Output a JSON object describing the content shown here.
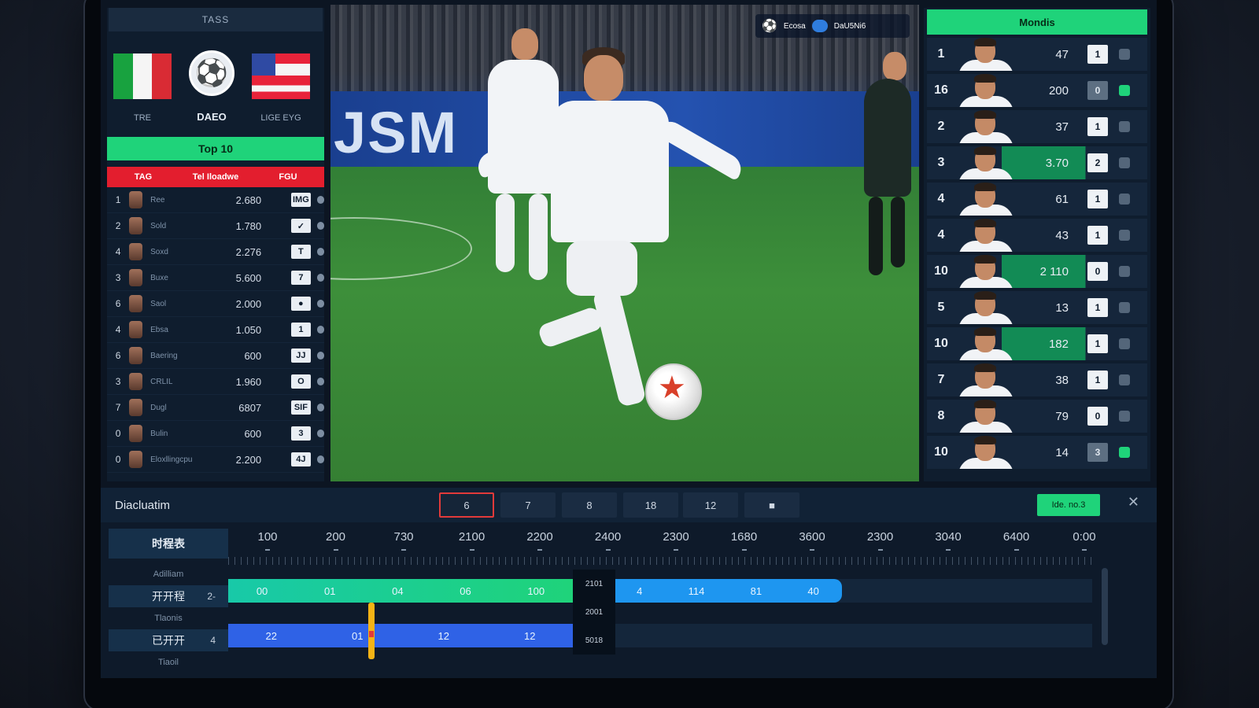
{
  "left_panel": {
    "header": "TASS",
    "team_left": "TRE",
    "team_mid": "DAEO",
    "team_right": "LIGE EYG",
    "top_button": "Top 10",
    "table_headers": [
      "TAG",
      "Tel Iloadwe",
      "FGU"
    ],
    "rows": [
      {
        "rank": "1",
        "name": "Ree",
        "score": "2.680",
        "box": "IMG"
      },
      {
        "rank": "2",
        "name": "Sold",
        "score": "1.780",
        "box": "✓"
      },
      {
        "rank": "4",
        "name": "Soxd",
        "score": "2.276",
        "box": "T"
      },
      {
        "rank": "3",
        "name": "Buxe",
        "score": "5.600",
        "box": "7"
      },
      {
        "rank": "6",
        "name": "Saol",
        "score": "2.000",
        "box": "●"
      },
      {
        "rank": "4",
        "name": "Ebsa",
        "score": "1.050",
        "box": "1"
      },
      {
        "rank": "6",
        "name": "Baering",
        "score": "600",
        "box": "JJ"
      },
      {
        "rank": "3",
        "name": "CRLIL",
        "score": "1.960",
        "box": "O"
      },
      {
        "rank": "7",
        "name": "Dugl",
        "score": "6807",
        "box": "SIF"
      },
      {
        "rank": "0",
        "name": "Bulin",
        "score": "600",
        "box": "3"
      },
      {
        "rank": "0",
        "name": "Eloxllingcpu",
        "score": "2.200",
        "box": "4J"
      }
    ]
  },
  "video": {
    "board_text": "JSM",
    "hud_label": "Ecosa",
    "hud_right": "DaU5Ni6"
  },
  "right_panel": {
    "header": "Mondis",
    "rows": [
      {
        "rank": "1",
        "value": "47",
        "box": "1",
        "icon": "gray"
      },
      {
        "rank": "16",
        "value": "200",
        "box": "0",
        "icon": "green",
        "dim": true
      },
      {
        "rank": "2",
        "value": "37",
        "box": "1",
        "icon": "gray"
      },
      {
        "rank": "3",
        "value": "3.70",
        "box": "2",
        "icon": "gray",
        "highlight": true
      },
      {
        "rank": "4",
        "value": "61",
        "box": "1",
        "icon": "gray"
      },
      {
        "rank": "4",
        "value": "43",
        "box": "1",
        "icon": "gray"
      },
      {
        "rank": "10",
        "value": "2 110",
        "box": "0",
        "icon": "gray",
        "highlight": true
      },
      {
        "rank": "5",
        "value": "13",
        "box": "1",
        "icon": "gray"
      },
      {
        "rank": "10",
        "value": "182",
        "box": "1",
        "icon": "gray",
        "highlight": true
      },
      {
        "rank": "7",
        "value": "38",
        "box": "1",
        "icon": "gray"
      },
      {
        "rank": "8",
        "value": "79",
        "box": "0",
        "icon": "gray"
      },
      {
        "rank": "10",
        "value": "14",
        "box": "3",
        "icon": "green",
        "dim": true
      }
    ]
  },
  "timeline": {
    "title": "Diacluatim",
    "tabs": [
      "6",
      "7",
      "8",
      "18",
      "12",
      "■"
    ],
    "action_button": "Ide. no.3",
    "ruler": [
      "100",
      "200",
      "730",
      "2100",
      "2200",
      "2400",
      "2300",
      "1680",
      "3600",
      "2300",
      "3040",
      "6400",
      "0:00"
    ],
    "track_labels": [
      "时程表",
      "Adilliam",
      "开开程",
      "Tlaonis",
      "已开开",
      "Tiaoil"
    ],
    "track_counts": [
      "2-",
      "4"
    ],
    "green_segs": [
      "00",
      "01",
      "04",
      "06",
      "100"
    ],
    "blue_segs": [
      "4",
      "114",
      "81",
      "40"
    ],
    "indigo_segs": [
      "22",
      "01",
      "12",
      "12"
    ],
    "popup": [
      "2101",
      "2001",
      "5018"
    ]
  },
  "colors": {
    "accent_green": "#1fd37a",
    "accent_red": "#e31e2e",
    "accent_blue": "#1e96f0",
    "bg": "#0c1522"
  }
}
